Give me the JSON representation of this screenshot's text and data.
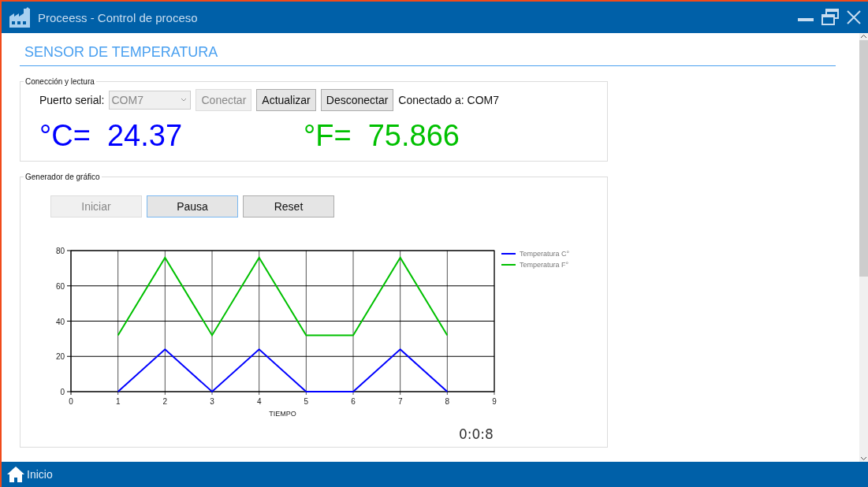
{
  "window": {
    "title": "Proceess - Control de proceso"
  },
  "heading": "SENSOR DE TEMPERATURA",
  "connection": {
    "legend": "Conección y lectura",
    "port_label": "Puerto serial:",
    "port": {
      "value": "COM7",
      "disabled": true
    },
    "buttons": [
      {
        "label": "Conectar",
        "disabled": true
      },
      {
        "label": "Actualizar",
        "disabled": false
      },
      {
        "label": "Desconectar",
        "disabled": false
      }
    ],
    "status": "Conectado a: COM7",
    "readings": [
      {
        "unit": "°C=",
        "value": "24.37",
        "color": "#0000ff"
      },
      {
        "unit": "°F=",
        "value": "75.866",
        "color": "#00c000"
      }
    ]
  },
  "graph": {
    "legend": "Generador de gráfico",
    "buttons": [
      {
        "label": "Iniciar",
        "disabled": true,
        "focused": false
      },
      {
        "label": "Pausa",
        "disabled": false,
        "focused": true
      },
      {
        "label": "Reset",
        "disabled": false,
        "focused": false
      }
    ],
    "chart_data": {
      "type": "line",
      "xlabel": "TIEMPO",
      "x": [
        1,
        2,
        3,
        4,
        5,
        6,
        7,
        8
      ],
      "xlim": [
        0,
        9
      ],
      "ylim": [
        0,
        80
      ],
      "xticks": [
        0,
        1,
        2,
        3,
        4,
        5,
        6,
        7,
        8,
        9
      ],
      "yticks": [
        0,
        20,
        40,
        60,
        80
      ],
      "grid": true,
      "legend": true,
      "series": [
        {
          "name": "Temperatura C°",
          "color": "#0000ff",
          "values": [
            0,
            24,
            0,
            24,
            0,
            0,
            24,
            0
          ]
        },
        {
          "name": "Temperatura F°",
          "color": "#00c000",
          "values": [
            32,
            76,
            32,
            76,
            32,
            32,
            76,
            32
          ]
        }
      ]
    },
    "timer": "0:0:8"
  },
  "footer": {
    "home": "Inicio"
  }
}
